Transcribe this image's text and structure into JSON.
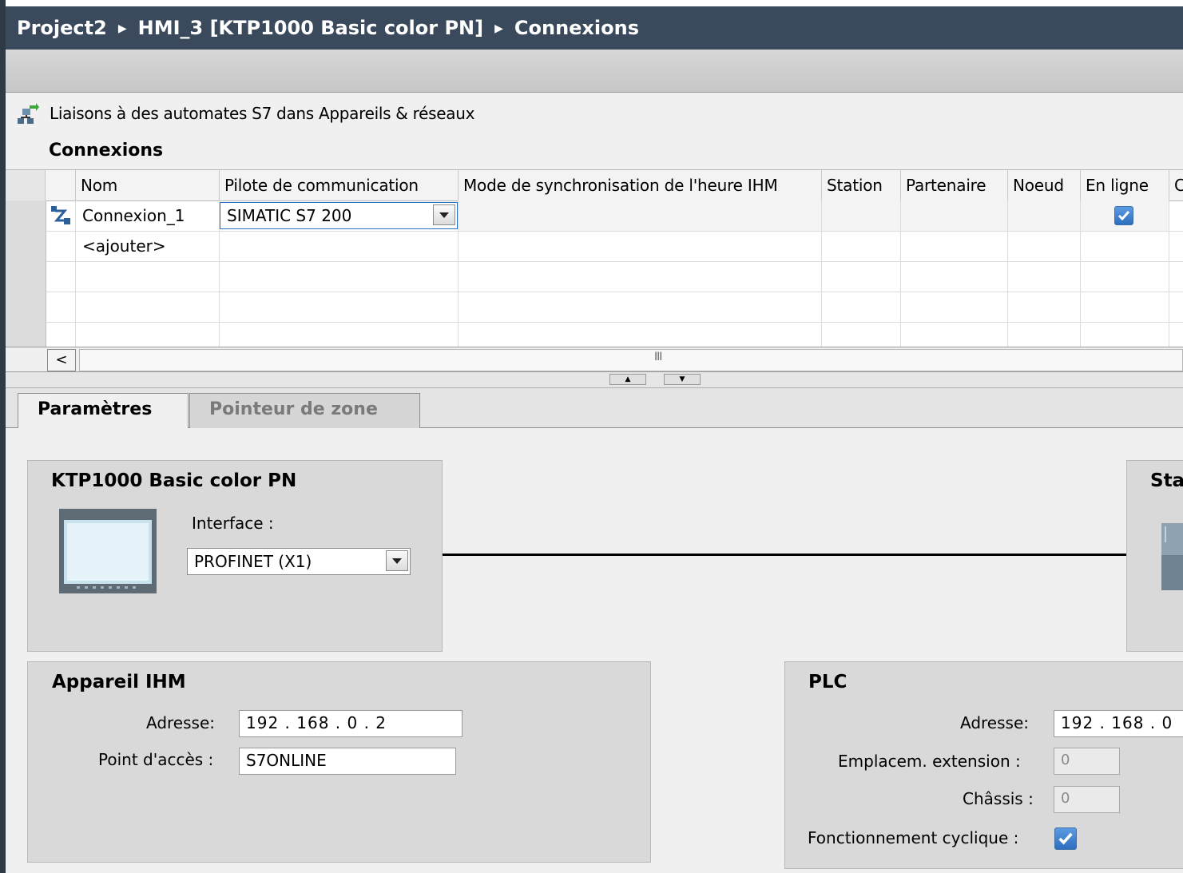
{
  "breadcrumb": {
    "project": "Project2",
    "device": "HMI_3 [KTP1000 Basic color PN]",
    "page": "Connexions",
    "separator": "▶"
  },
  "link_row": {
    "icon": "network-devices-icon",
    "text": "Liaisons à des automates S7 dans Appareils & réseaux"
  },
  "section_title": "Connexions",
  "table": {
    "columns": [
      "Nom",
      "Pilote de communication",
      "Mode de synchronisation de l'heure IHM",
      "Station",
      "Partenaire",
      "Noeud",
      "En ligne",
      "C"
    ],
    "rows": [
      {
        "icon": "connection-icon",
        "name": "Connexion_1",
        "driver": "SIMATIC S7 200",
        "time_sync": "",
        "station": "",
        "partner": "",
        "node": "",
        "online": true
      }
    ],
    "add_row_label": "<ajouter>",
    "scroll_left_glyph": "<",
    "scroll_grip_glyph": "III"
  },
  "tabs": [
    {
      "label": "Paramètres",
      "active": true
    },
    {
      "label": "Pointeur de zone",
      "active": false
    }
  ],
  "device_panel": {
    "title": "KTP1000 Basic color PN",
    "interface_label": "Interface :",
    "interface_value": "PROFINET (X1)"
  },
  "station_panel": {
    "title": "Sta"
  },
  "hmi_panel": {
    "title": "Appareil IHM",
    "address_label": "Adresse:",
    "address_value": "192 . 168 . 0    . 2",
    "access_point_label": "Point d'accès :",
    "access_point_value": "S7ONLINE"
  },
  "plc_panel": {
    "title": "PLC",
    "address_label": "Adresse:",
    "address_value": "192 . 168 . 0",
    "slot_label": "Emplacem. extension :",
    "slot_value": "0",
    "rack_label": "Châssis :",
    "rack_value": "0",
    "cyclic_label": "Fonctionnement cyclique :",
    "cyclic_checked": true
  },
  "colors": {
    "title_bar": "#3a4a5c",
    "panel_bg": "#d9d9d9",
    "checkbox": "#2c6fc0"
  }
}
